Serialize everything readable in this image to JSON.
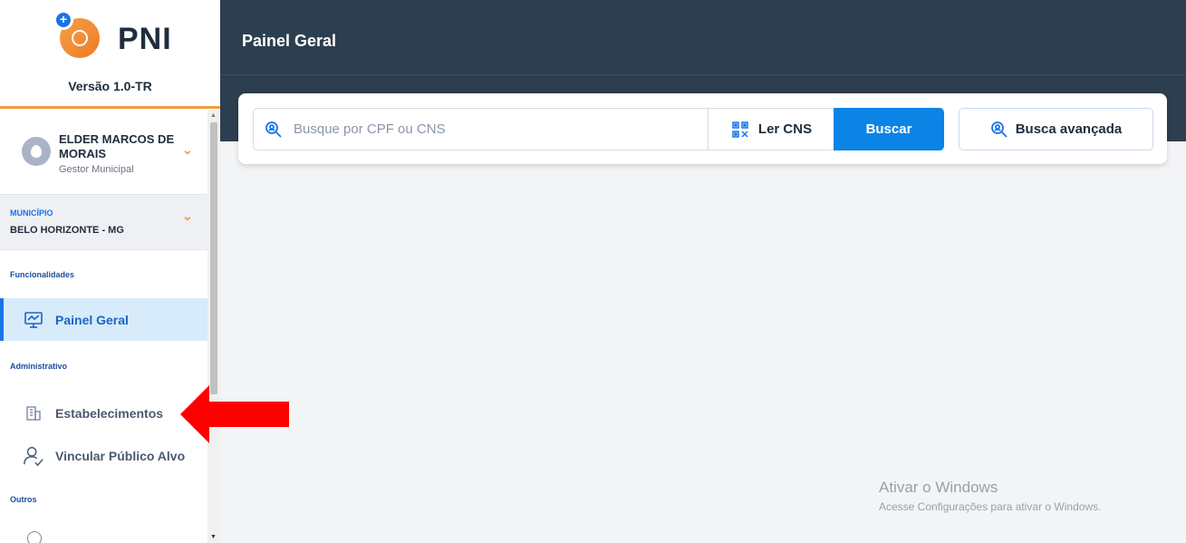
{
  "brand": {
    "name": "PNI",
    "version": "Versão 1.0-TR"
  },
  "user": {
    "name": "ELDER MARCOS DE MORAIS",
    "role": "Gestor Municipal"
  },
  "municipio": {
    "label": "MUNICÍPIO",
    "value": "BELO HORIZONTE - MG"
  },
  "sidebar": {
    "sections": [
      {
        "label": "Funcionalidades"
      },
      {
        "label": "Administrativo"
      },
      {
        "label": "Outros"
      }
    ],
    "items": [
      {
        "label": "Painel Geral",
        "icon": "dashboard-icon",
        "active": true
      },
      {
        "label": "Estabelecimentos",
        "icon": "building-icon",
        "active": false
      },
      {
        "label": "Vincular Público Alvo",
        "icon": "user-check-icon",
        "active": false
      }
    ]
  },
  "header": {
    "title": "Painel Geral"
  },
  "search": {
    "placeholder": "Busque por CPF ou CNS",
    "read_label": "Ler CNS",
    "submit_label": "Buscar",
    "advanced_label": "Busca avançada"
  },
  "watermark": {
    "title": "Ativar o Windows",
    "subtitle": "Acesse Configurações para ativar o Windows."
  },
  "colors": {
    "header_bg": "#2d3e50",
    "primary": "#0b84e6",
    "accent": "#f39c3d",
    "annotation": "#ff0000"
  }
}
